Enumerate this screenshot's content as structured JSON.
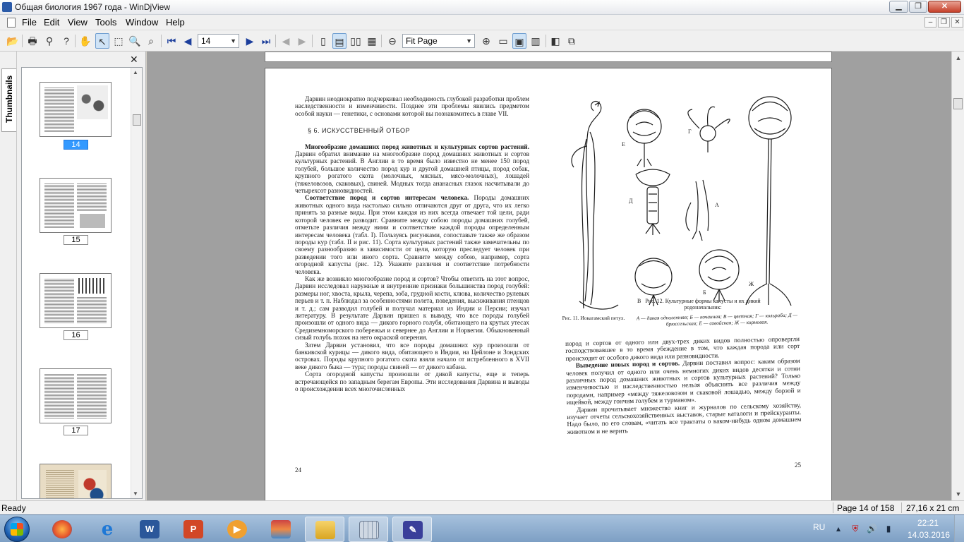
{
  "window": {
    "title": "Общая биология 1967 года - WinDjView",
    "minimize": "▁",
    "maximize": "❐",
    "close": "✕"
  },
  "menu": {
    "items": [
      "File",
      "Edit",
      "View",
      "Tools",
      "Window",
      "Help"
    ],
    "mdi_minimize": "–",
    "mdi_restore": "❐",
    "mdi_close": "✕"
  },
  "toolbar": {
    "page_value": "14",
    "zoom_value": "Fit Page"
  },
  "sidebar": {
    "tab_label": "Thumbnails",
    "close": "✕",
    "thumbnails": [
      {
        "label": "14",
        "selected": true
      },
      {
        "label": "15",
        "selected": false
      },
      {
        "label": "16",
        "selected": false
      },
      {
        "label": "17",
        "selected": false
      },
      {
        "label": "",
        "selected": false
      }
    ]
  },
  "document": {
    "left": {
      "intro": "Дарвин неоднократно подчеркивал необходимость глубокой разработки проблем наследственности и изменчивости. Позднее эти проблемы явились предметом особой науки — генетики, с основами которой вы познакомитесь в главе VII.",
      "section": "§ 6. ИСКУССТВЕННЫЙ ОТБОР",
      "p1_bold": "Многообразие домашних пород животных и культурных сортов растений.",
      "p1": " Дарвин обратил внимание на многообразие пород домашних животных и сортов культурных растений. В Англии в то время было известно не менее 150 пород голубей, большое количество пород кур и другой домашней птицы, пород собак, крупного рогатого скота (молочных, мясных, мясо-молочных), лошадей (тяжеловозов, скаковых), свиней. Модных тогда ананасных глазок насчитывали до четырехсот разновидностей.",
      "p2_bold": "Соответствие пород и сортов интересам человека.",
      "p2": " Породы домашних животных одного вида настолько сильно отличаются друг от друга, что их легко принять за разные виды. При этом каждая из них всегда отвечает той цели, ради которой человек ее разводит. Сравните между собою породы домашних голубей, отметьте различия между ними и соответствие каждой породы определенным интересам человека (табл. I). Пользуясь рисунками, сопоставьте также же образом породы кур (табл. II и рис. 11). Сорта культурных растений также замечательны по своему разнообразию в зависимости от цели, которую преследует человек при разведении того или иного сорта. Сравните между собою, например, сорта огородной капусты (рис. 12). Укажите различия и соответствие потребности человека.",
      "p3": "Как же возникло многообразие пород и сортов? Чтобы ответить на этот вопрос, Дарвин исследовал наружные и внутренние признаки большинства пород голубей: размеры ног, хвоста, крыла, черепа, зоба, грудной кости, клюва, количество рулевых перьев и т. п. Наблюдал за особенностями полета, поведения, высиживания птенцов и т. д.; сам разводил голубей и получал материал из Индии и Персии; изучал литературу. В результате Дарвин пришел к выводу, что все породы голубей произошли от одного вида — дикого горного голубя, обитающего на крутых утесах Средиземноморского побережья и севернее до Англии и Норвегии. Обыкновенный сизый голубь похож на него окраской оперения.",
      "p4": "Затем Дарвин установил, что все породы домашних кур произошли от банкивской курицы — дикого вида, обитающего в Индии, на Цейлоне и Зондских островах. Породы крупного рогатого скота взяли начало от истребленного в XVII веке дикого быка — тура; породы свиней — от дикого кабана.",
      "p5": "Сорта огородной капусты произошли от дикой капусты, еще и теперь встречающейся по западным берегам Европы. Эти исследования Дарвина и выводы о происхождении всех многочисленных",
      "page_number": "24"
    },
    "figures": {
      "fig11_caption": "Рис. 11. Иокагамский петух.",
      "fig12_caption": "Рис. 12. Культурные формы капусты и их дикий родоначальник:",
      "fig12_legend": "А — дикая однолетняя; Б — кочанная; В — цветная; Г — кольраби; Д — брюссельская; Е — савойская; Ж — кормовая.",
      "labels": [
        "Е",
        "Г",
        "Д",
        "А",
        "В",
        "Б",
        "Ж"
      ]
    },
    "right": {
      "p1": "пород и сортов от одного или двух-трех диких видов полностью опровергли господствовавшее в то время убеждение в том, что каждая порода или сорт происходит от особого дикого вида или разновидности.",
      "p2_bold": "Выведение новых пород и сортов.",
      "p2": " Дарвин поставил вопрос: каким образом человек получил от одного или очень немногих диких видов десятки и сотни различных пород домашних животных и сортов культурных растений? Только изменчивостью и наследственностью нельзя объяснить все различия между породами, например «между тяжеловозом и скаковой лошадью, между борзой и ищейкой, между гончим голубем и турманом».",
      "p3": "Дарвин прочитывает множество книг и журналов по сельскому хозяйству, изучает отчеты сельскохозяйственных выставок, старые каталоги и прейскуранты. Надо было, по его словам, «читать все трактаты о каком-нибудь одном домашнем животном и не верить",
      "page_number": "25"
    }
  },
  "status": {
    "ready": "Ready",
    "page": "Page 14 of 158",
    "size": "27,16 x 21 cm"
  },
  "taskbar": {
    "apps": [
      "firefox-app",
      "ie-app",
      "word-app",
      "powerpoint-app",
      "media-player-app",
      "winrar-app",
      "explorer-app",
      "calculator-app",
      "windjview-app"
    ],
    "lang": "RU",
    "time": "22:21",
    "date": "14.03.2016"
  },
  "colors": {
    "selection": "#3399ff",
    "doc_background": "#a0a0a0",
    "taskbar": "#7d9fc4"
  }
}
